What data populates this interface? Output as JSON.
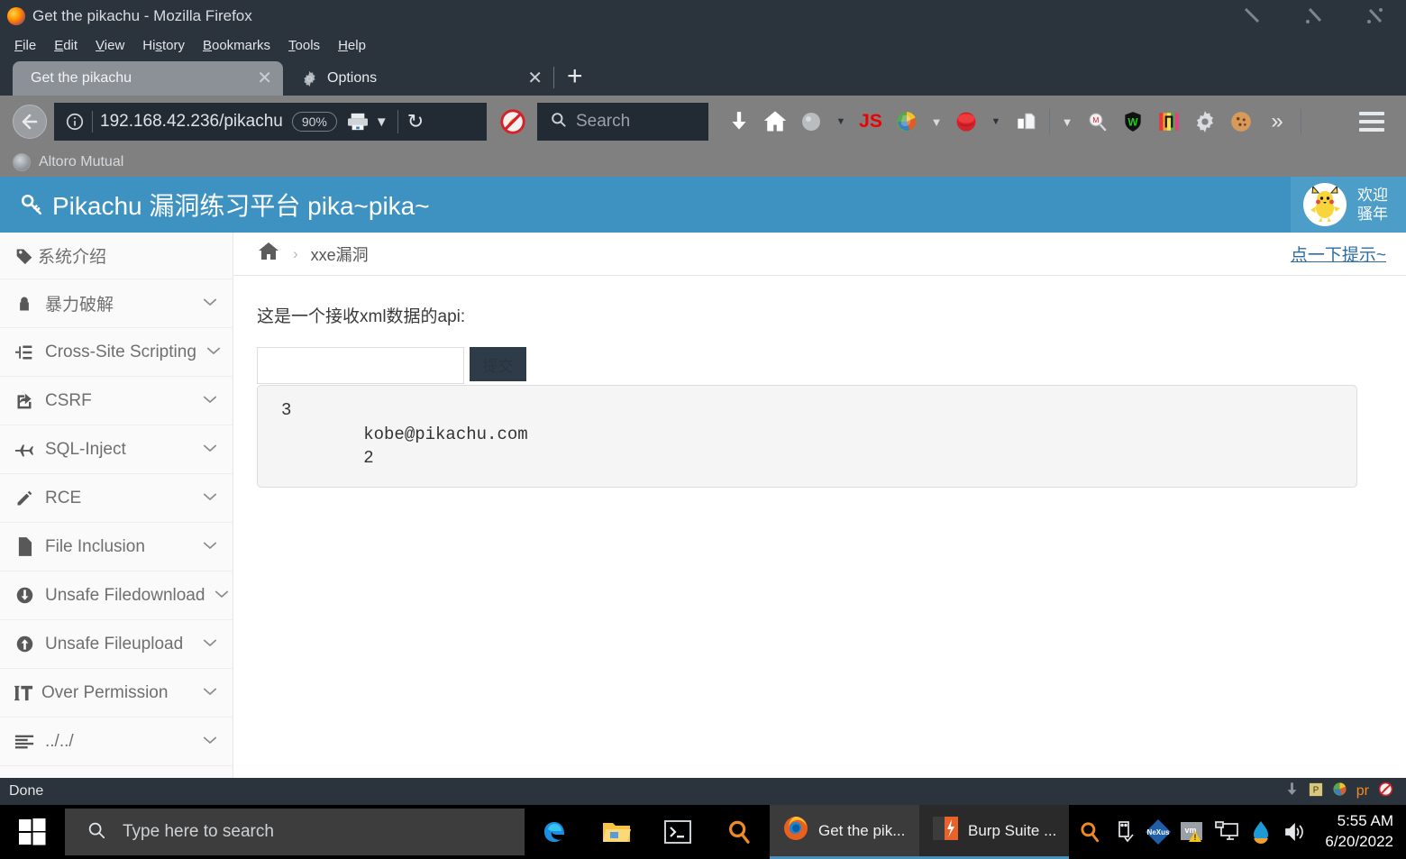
{
  "window": {
    "title": "Get the pikachu - Mozilla Firefox",
    "controls": {
      "minimize": "minimize-icon",
      "maximize": "maximize-icon",
      "close": "close-icon"
    }
  },
  "menubar": [
    {
      "label": "File",
      "accel": "F"
    },
    {
      "label": "Edit",
      "accel": "E"
    },
    {
      "label": "View",
      "accel": "V"
    },
    {
      "label": "History",
      "accel": "s"
    },
    {
      "label": "Bookmarks",
      "accel": "B"
    },
    {
      "label": "Tools",
      "accel": "T"
    },
    {
      "label": "Help",
      "accel": "H"
    }
  ],
  "tabs": [
    {
      "label": "Get the pikachu",
      "active": true,
      "close": "✕"
    },
    {
      "label": "Options",
      "active": false,
      "close": "✕",
      "icon": "gear-icon"
    }
  ],
  "newtab_label": "+",
  "navbar": {
    "back_glyph": "←",
    "identity_icon": "info-circle-icon",
    "url": "192.168.42.236/pikachu",
    "zoom_level": "90%",
    "reload_glyph": "↻",
    "printer_icon": "printer-icon",
    "dropdown_glyph": "▼",
    "noscript_icon": "noscript-icon",
    "extensions": [
      {
        "name": "downloads-icon"
      },
      {
        "name": "home-icon"
      },
      {
        "name": "wappalyzer-icon"
      },
      {
        "name": "javascript-toggle-icon",
        "label": "JS"
      },
      {
        "name": "sync-icon"
      },
      {
        "name": "hackbar-icon"
      },
      {
        "name": "proxy-switch-icon"
      },
      {
        "name": "search-magnifier-icon"
      },
      {
        "name": "wayback-shield-icon",
        "label": "W"
      },
      {
        "name": "colorpicker-icon"
      },
      {
        "name": "settings-gear-icon"
      },
      {
        "name": "cookie-editor-icon"
      },
      {
        "name": "overflow-chevrons-icon",
        "label": "»"
      }
    ],
    "menu_icon": "hamburger-menu-icon"
  },
  "search": {
    "placeholder": "Search",
    "icon": "search-icon"
  },
  "bookmarks": [
    {
      "label": "Altoro Mutual",
      "icon": "globe-icon"
    }
  ],
  "pikachu": {
    "brand_title": "Pikachu 漏洞练习平台 pika~pika~",
    "brand_icon": "key-icon",
    "greeting_line1": "欢迎",
    "greeting_line2": "骚年",
    "avatar": "pikachu-avatar",
    "header_color": "#3e92c2",
    "sidebar": [
      {
        "label": "系统介绍",
        "icon": "tag-icon",
        "chevron": ""
      },
      {
        "label": "暴力破解",
        "icon": "lock-icon",
        "chevron": "⌄"
      },
      {
        "label": "Cross-Site Scripting",
        "icon": "sitemap-icon",
        "chevron": "⌄"
      },
      {
        "label": "CSRF",
        "icon": "share-square-icon",
        "chevron": "⌄"
      },
      {
        "label": "SQL-Inject",
        "icon": "plane-icon",
        "chevron": "⌄"
      },
      {
        "label": "RCE",
        "icon": "pencil-icon",
        "chevron": "⌄"
      },
      {
        "label": "File Inclusion",
        "icon": "file-icon",
        "chevron": "⌄"
      },
      {
        "label": "Unsafe Filedownload",
        "icon": "download-circle-icon",
        "chevron": "⌄"
      },
      {
        "label": "Unsafe Fileupload",
        "icon": "upload-circle-icon",
        "chevron": "⌄"
      },
      {
        "label": "Over Permission",
        "icon": "text-height-icon",
        "chevron": "⌄"
      },
      {
        "label": "../../",
        "icon": "align-left-icon",
        "chevron": "⌄"
      }
    ],
    "breadcrumb": {
      "home_icon": "home-icon",
      "separator": "›",
      "current": "xxe漏洞"
    },
    "hint_link": "点一下提示~",
    "api_label": "这是一个接收xml数据的api:",
    "input_value": "",
    "input_placeholder": "",
    "submit_label": "提交",
    "result_lines": [
      "3",
      "        kobe@pikachu.com",
      "        2"
    ]
  },
  "statusbar": {
    "text": "Done",
    "icons": [
      "download-arrow-icon",
      "proxy-badge-icon",
      "sync-icon",
      "pr-badge-icon",
      "noscript-icon"
    ]
  },
  "taskbar": {
    "start_icon": "windows-start-icon",
    "search_placeholder": "Type here to search",
    "search_icon": "search-icon",
    "pinned": [
      {
        "name": "edge-icon"
      },
      {
        "name": "file-explorer-icon"
      },
      {
        "name": "terminal-icon"
      },
      {
        "name": "search-everything-icon"
      }
    ],
    "windows": [
      {
        "label": "Get the pik...",
        "icon": "firefox-icon",
        "active": true
      },
      {
        "label": "Burp Suite ...",
        "icon": "burp-suite-icon",
        "active": false
      }
    ],
    "tray": [
      {
        "name": "search-everything-tray-icon"
      },
      {
        "name": "usb-eject-icon"
      },
      {
        "name": "nexus-icon"
      },
      {
        "name": "vmware-warning-icon"
      },
      {
        "name": "remote-desktop-icon"
      },
      {
        "name": "water-drop-icon"
      },
      {
        "name": "volume-icon"
      }
    ],
    "clock_time": "5:55 AM",
    "clock_date": "6/20/2022"
  }
}
